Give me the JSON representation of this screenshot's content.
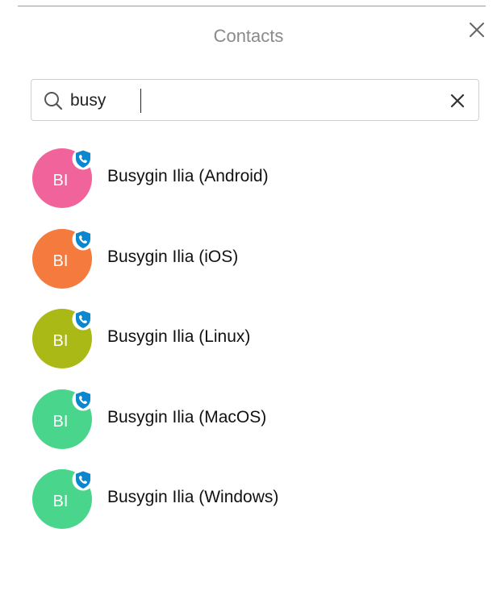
{
  "header": {
    "title": "Contacts",
    "close_icon": "close-icon"
  },
  "search": {
    "value": "busy",
    "search_icon": "search-icon",
    "clear_icon": "clear-icon"
  },
  "contacts": [
    {
      "initials": "BI",
      "name": "Busygin Ilia (Android)",
      "color": "#f0649b"
    },
    {
      "initials": "BI",
      "name": "Busygin Ilia (iOS)",
      "color": "#f57a3d"
    },
    {
      "initials": "BI",
      "name": "Busygin Ilia (Linux)",
      "color": "#aab916"
    },
    {
      "initials": "BI",
      "name": "Busygin Ilia (MacOS)",
      "color": "#49d58c"
    },
    {
      "initials": "BI",
      "name": "Busygin Ilia (Windows)",
      "color": "#49d58c"
    }
  ],
  "badge": {
    "icon": "secure-call-shield-icon",
    "color": "#0b87cf"
  }
}
